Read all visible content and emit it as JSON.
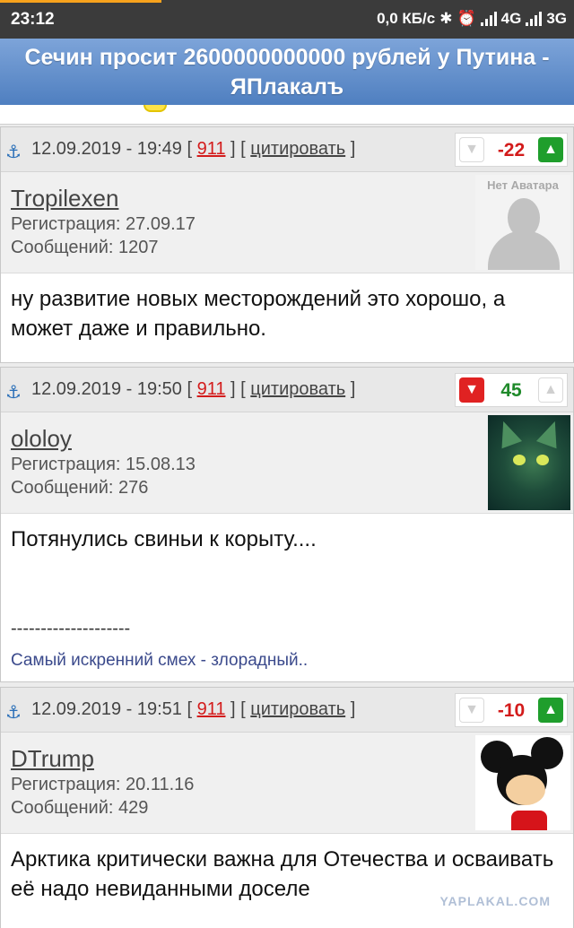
{
  "status_bar": {
    "time": "23:12",
    "speed": "0,0 КБ/с",
    "net1": "4G",
    "net2": "3G",
    "icons": [
      "bluetooth-icon",
      "alarm-icon",
      "signal-icon",
      "signal-icon"
    ]
  },
  "page": {
    "title": "Сечин просит 2600000000000 рублей у Путина - ЯПлакалъ"
  },
  "posts": [
    {
      "datetime": "12.09.2019 - 19:49",
      "number": "911",
      "quote_label": "цитировать",
      "score": "-22",
      "score_color": "#d31b1b",
      "vote_state": "up-active",
      "username": "Tropilexen",
      "registration": "Регистрация: 27.09.17",
      "messages": "Сообщений: 1207",
      "avatar_label": "Нет Аватара",
      "text": "ну развитие новых месторождений это хорошо, а может даже и правильно."
    },
    {
      "datetime": "12.09.2019 - 19:50",
      "number": "911",
      "quote_label": "цитировать",
      "score": "45",
      "score_color": "#1f8a2a",
      "vote_state": "down-active",
      "username": "ololoy",
      "registration": "Регистрация: 15.08.13",
      "messages": "Сообщений: 276",
      "text": "Потянулись свиньи к корыту....",
      "signature_line": "--------------------",
      "signature": "Самый искренний смех - злорадный.."
    },
    {
      "datetime": "12.09.2019 - 19:51",
      "number": "911",
      "quote_label": "цитировать",
      "score": "-10",
      "score_color": "#d31b1b",
      "vote_state": "up-active",
      "username": "DTrump",
      "registration": "Регистрация: 20.11.16",
      "messages": "Сообщений: 429",
      "text": "Арктика критически важна для Отечества и осваивать её надо невиданными доселе"
    }
  ],
  "watermark": "YAPLAKAL.COM"
}
